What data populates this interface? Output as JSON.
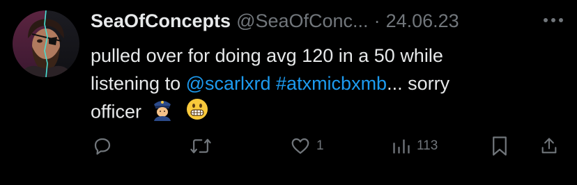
{
  "tweet": {
    "display_name": "SeaOfConcepts",
    "handle": "@SeaOfConc...",
    "separator": "·",
    "date": "24.06.23",
    "text": {
      "line1": "pulled over for doing avg 120 in a 50 while",
      "line2_prefix": "listening to ",
      "mention": "@scarlxrd",
      "hashtag": "#atxmicbxmb",
      "line2_suffix": "... sorry",
      "line3": "officer"
    },
    "emojis": [
      "police-officer-emoji",
      "grimacing-face-emoji"
    ]
  },
  "actions": {
    "reply": {
      "icon": "reply-icon"
    },
    "retweet": {
      "icon": "retweet-icon"
    },
    "like": {
      "icon": "heart-icon",
      "count": "1"
    },
    "views": {
      "icon": "views-icon",
      "count": "113"
    },
    "bookmark": {
      "icon": "bookmark-icon"
    },
    "share": {
      "icon": "share-icon"
    }
  },
  "colors": {
    "background": "#000000",
    "text": "#e7e9ea",
    "secondary": "#71767b",
    "link": "#1d9bf0"
  }
}
